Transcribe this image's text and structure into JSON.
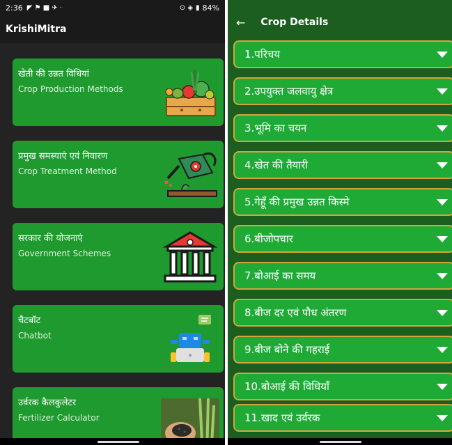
{
  "status_bar": {
    "time": "2:36",
    "battery": "84%"
  },
  "app_title": "KrishiMitra",
  "menu": [
    {
      "hindi": "खेती की उन्नत विधियां",
      "english": "Crop Production Methods",
      "icon": "vegetable-crate-icon"
    },
    {
      "hindi": "प्रमुख समस्याएं एवं निवारण",
      "english": "Crop Treatment Method",
      "icon": "watering-can-icon"
    },
    {
      "hindi": "सरकार की योजनाएं",
      "english": "Government Schemes",
      "icon": "government-building-icon"
    },
    {
      "hindi": "चैटबॉट",
      "english": "Chatbot",
      "icon": "robot-icon"
    },
    {
      "hindi": "उर्वरक कैलकुलेटर",
      "english": "Fertilizer Calculator",
      "icon": "fertilizer-photo-icon"
    }
  ],
  "details": {
    "title": "Crop Details",
    "sections": [
      "1.परिचय",
      "2.उपयुक्त जलवायु क्षेत्र",
      "3.भूमि का चयन",
      "4.खेत की तैयारी",
      "5.गेहूँ की प्रमुख उन्नत किस्मे",
      "6.बीजोपचार",
      "7.बोआई का समय",
      "8.बीज दर एवं पौध अंतरण",
      "9.बीज बोने की गहराई",
      "10.बोआई की विधियाँ",
      "11.खाद एवं उर्वरक"
    ]
  },
  "colors": {
    "card_green": "#1e9a2e",
    "accordion_green": "#1faa36",
    "accordion_border": "#d4a53c",
    "detail_bg": "#1b5e20"
  }
}
